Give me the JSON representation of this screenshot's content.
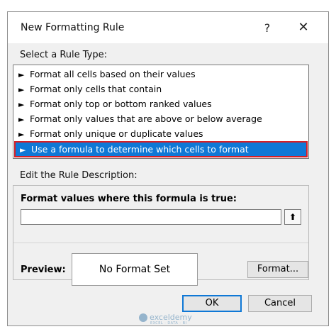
{
  "window": {
    "title": "New Formatting Rule",
    "help": "?",
    "close": "✕"
  },
  "rule_type": {
    "heading": "Select a Rule Type:",
    "items": [
      {
        "label": "Format all cells based on their values",
        "selected": false
      },
      {
        "label": "Format only cells that contain",
        "selected": false
      },
      {
        "label": "Format only top or bottom ranked values",
        "selected": false
      },
      {
        "label": "Format only values that are above or below average",
        "selected": false
      },
      {
        "label": "Format only unique or duplicate values",
        "selected": false
      },
      {
        "label": "Use a formula to determine which cells to format",
        "selected": true
      }
    ],
    "arrow_glyph": "►"
  },
  "description": {
    "heading": "Edit the Rule Description:",
    "formula_label": "Format values where this formula is true:",
    "formula_value": "",
    "collapse_glyph": "⬆",
    "preview_label": "Preview:",
    "preview_text": "No Format Set",
    "format_button": "Format..."
  },
  "buttons": {
    "ok": "OK",
    "cancel": "Cancel"
  },
  "watermark": {
    "name": "exceldemy",
    "tagline": "EXCEL · DATA · BI"
  },
  "colors": {
    "selection": "#0f78d6",
    "highlight_outline": "#d61f26"
  }
}
